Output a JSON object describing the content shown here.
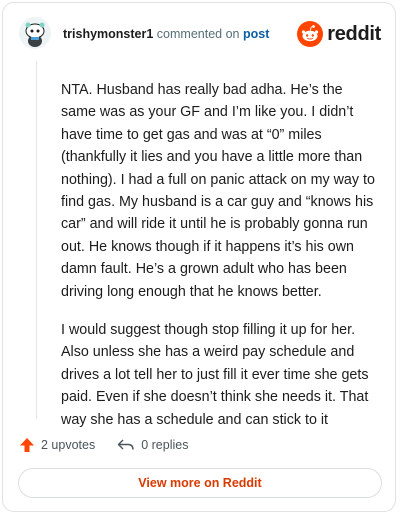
{
  "header": {
    "username": "trishymonster1",
    "commented_on": "commented on",
    "post_link": "post",
    "logo_text": "reddit"
  },
  "comment": {
    "paragraphs": [
      "NTA. Husband has really bad adha. He’s the same was as your GF and I’m like you. I didn’t have time to get gas and was at “0” miles (thankfully it lies and you have a little more than nothing). I had a full on panic attack on my way to find gas. My husband is a car guy and “knows his car” and will ride it until he is probably gonna run out. He knows though if it happens it’s his own damn fault. He’s a grown adult who has been driving long enough that he knows better.",
      "I would suggest though stop filling it up for her. Also unless she has a weird pay schedule and drives a lot tell her to just fill it ever time she gets paid. Even if she doesn’t think she needs it. That way she has a schedule and can stick to it"
    ]
  },
  "actions": {
    "upvotes": "2 upvotes",
    "replies": "0 replies"
  },
  "footer": {
    "view_more": "View more on Reddit"
  },
  "colors": {
    "brand": "#ff4500",
    "link": "#0b5fa5",
    "view_more": "#d93a00"
  },
  "icons": {
    "avatar": "snoo-avatar",
    "logo": "reddit-snoo-icon",
    "upvote": "upvote-arrow-icon",
    "reply": "reply-arrow-icon"
  }
}
